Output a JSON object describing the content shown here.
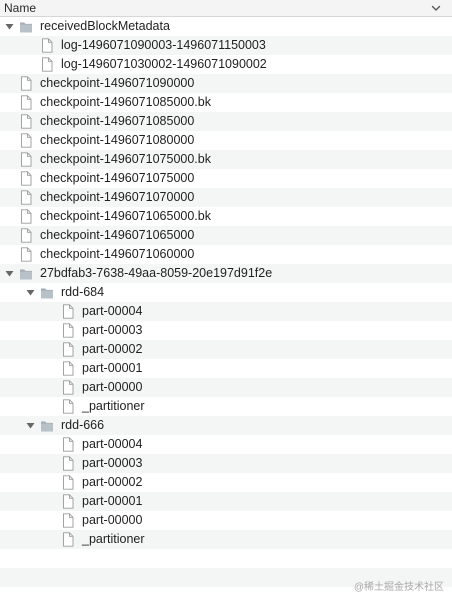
{
  "header": {
    "name_label": "Name",
    "sort_icon": "chevron-down-icon"
  },
  "rows": [
    {
      "label": "receivedBlockMetadata",
      "type": "folder",
      "depth": 0,
      "expanded": true
    },
    {
      "label": "log-1496071090003-1496071150003",
      "type": "file",
      "depth": 1
    },
    {
      "label": "log-1496071030002-1496071090002",
      "type": "file",
      "depth": 1
    },
    {
      "label": "checkpoint-1496071090000",
      "type": "file",
      "depth": 0
    },
    {
      "label": "checkpoint-1496071085000.bk",
      "type": "file",
      "depth": 0
    },
    {
      "label": "checkpoint-1496071085000",
      "type": "file",
      "depth": 0
    },
    {
      "label": "checkpoint-1496071080000",
      "type": "file",
      "depth": 0
    },
    {
      "label": "checkpoint-1496071075000.bk",
      "type": "file",
      "depth": 0
    },
    {
      "label": "checkpoint-1496071075000",
      "type": "file",
      "depth": 0
    },
    {
      "label": "checkpoint-1496071070000",
      "type": "file",
      "depth": 0
    },
    {
      "label": "checkpoint-1496071065000.bk",
      "type": "file",
      "depth": 0
    },
    {
      "label": "checkpoint-1496071065000",
      "type": "file",
      "depth": 0
    },
    {
      "label": "checkpoint-1496071060000",
      "type": "file",
      "depth": 0
    },
    {
      "label": "27bdfab3-7638-49aa-8059-20e197d91f2e",
      "type": "folder",
      "depth": 0,
      "expanded": true
    },
    {
      "label": "rdd-684",
      "type": "folder",
      "depth": 1,
      "expanded": true
    },
    {
      "label": "part-00004",
      "type": "file",
      "depth": 2
    },
    {
      "label": "part-00003",
      "type": "file",
      "depth": 2
    },
    {
      "label": "part-00002",
      "type": "file",
      "depth": 2
    },
    {
      "label": "part-00001",
      "type": "file",
      "depth": 2
    },
    {
      "label": "part-00000",
      "type": "file",
      "depth": 2
    },
    {
      "label": "_partitioner",
      "type": "file",
      "depth": 2
    },
    {
      "label": "rdd-666",
      "type": "folder",
      "depth": 1,
      "expanded": true
    },
    {
      "label": "part-00004",
      "type": "file",
      "depth": 2
    },
    {
      "label": "part-00003",
      "type": "file",
      "depth": 2
    },
    {
      "label": "part-00002",
      "type": "file",
      "depth": 2
    },
    {
      "label": "part-00001",
      "type": "file",
      "depth": 2
    },
    {
      "label": "part-00000",
      "type": "file",
      "depth": 2
    },
    {
      "label": "_partitioner",
      "type": "file",
      "depth": 2
    },
    {
      "label": "",
      "type": "empty"
    },
    {
      "label": "",
      "type": "empty"
    },
    {
      "label": "",
      "type": "empty"
    }
  ],
  "watermark": "@稀土掘金技术社区",
  "colors": {
    "folder_fill": "#b8c0c8",
    "folder_tab": "#a4adb7",
    "file_stroke": "#9a9a9a",
    "row_alt": "#f4f5f5"
  }
}
